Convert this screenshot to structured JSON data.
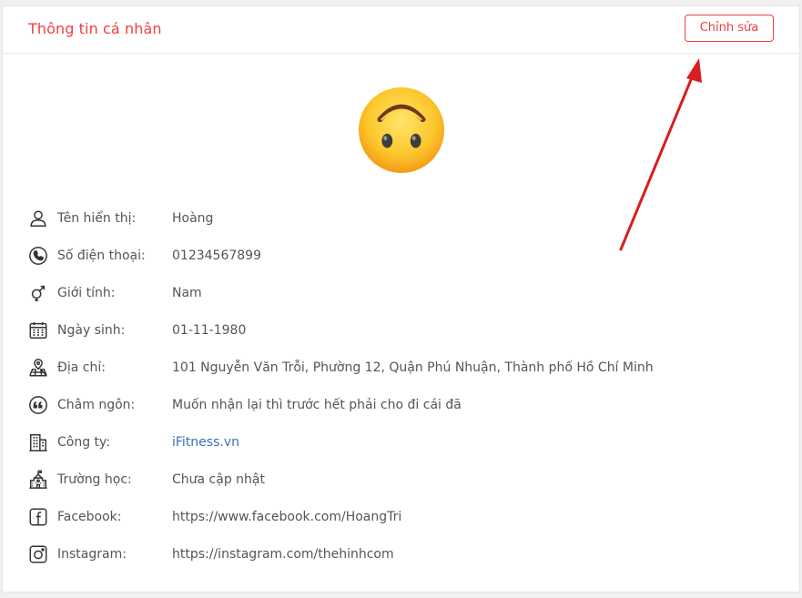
{
  "header": {
    "title": "Thông tin cá nhân",
    "edit_label": "Chỉnh sửa"
  },
  "profile": {
    "rows": [
      {
        "icon": "user-icon",
        "label": "Tên hiển thị:",
        "value": "Hoàng"
      },
      {
        "icon": "phone-icon",
        "label": "Số điện thoại:",
        "value": "01234567899"
      },
      {
        "icon": "gender-icon",
        "label": "Giới tính:",
        "value": "Nam"
      },
      {
        "icon": "calendar-icon",
        "label": "Ngày sinh:",
        "value": "01-11-1980"
      },
      {
        "icon": "map-pin-icon",
        "label": "Địa chỉ:",
        "value": "101 Nguyễn Văn Trỗi, Phường 12, Quận Phú Nhuận, Thành phố Hồ Chí Minh"
      },
      {
        "icon": "quote-icon",
        "label": "Châm ngôn:",
        "value": "Muốn nhận lại thì trước hết phải cho đi cái đã"
      },
      {
        "icon": "building-icon",
        "label": "Công ty:",
        "value": "iFitness.vn"
      },
      {
        "icon": "school-icon",
        "label": "Trường học:",
        "value": "Chưa cập nhật"
      },
      {
        "icon": "facebook-icon",
        "label": "Facebook:",
        "value": "https://www.facebook.com/HoangTri"
      },
      {
        "icon": "instagram-icon",
        "label": "Instagram:",
        "value": "https://instagram.com/thehinhcom"
      }
    ]
  },
  "colors": {
    "accent": "#ee3f3f",
    "link": "#3a6fb5",
    "arrow": "#d81e1e"
  }
}
